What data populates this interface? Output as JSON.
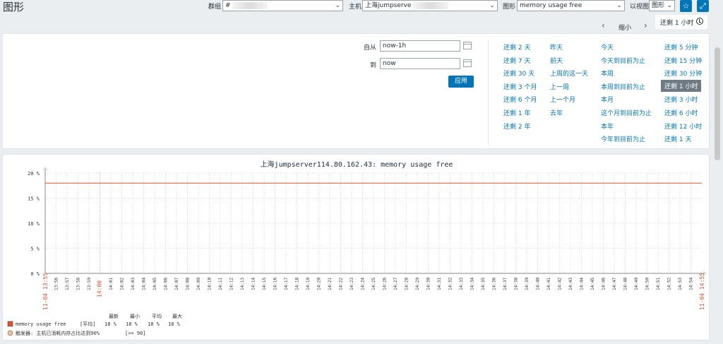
{
  "header": {
    "title": "图形",
    "group_label": "群组",
    "group_value": "#",
    "host_label": "主机",
    "host_value": "上海jumpserve",
    "graph_label": "图形",
    "graph_value": "memory usage free",
    "view_label": "以视图",
    "view_value": "图形"
  },
  "timebar": {
    "zoom_label": "缩小",
    "period_tab": "还剩 1 小时"
  },
  "filter": {
    "from_label": "自从",
    "from_value": "now-1h",
    "to_label": "到",
    "to_value": "now",
    "apply_label": "应用",
    "quick_ranges": [
      [
        "还剩 2 天",
        "还剩 7 天",
        "还剩 30 天",
        "还剩 3 个月",
        "还剩 6 个月",
        "还剩 1 年",
        "还剩 2 年"
      ],
      [
        "昨天",
        "前天",
        "上周的这一天",
        "上一周",
        "上一个月",
        "去年"
      ],
      [
        "今天",
        "今天到目前为止",
        "本周",
        "本周到目前为止",
        "本月",
        "这个月到目前为止",
        "本年",
        "今年到目前为止"
      ],
      [
        "还剩 5 分钟",
        "还剩 15 分钟",
        "还剩 30 分钟",
        "还剩 1 小时",
        "还剩 3 小时",
        "还剩 6 小时",
        "还剩 12 小时",
        "还剩 1 天"
      ]
    ],
    "active_range": "还剩 1 小时"
  },
  "chart_data": {
    "type": "line",
    "title": "上海jumpserver114.80.162.43: memory usage free",
    "ylim": [
      0,
      20
    ],
    "yticks": [
      "0 %",
      "5 %",
      "10 %",
      "15 %",
      "20 %"
    ],
    "x_start_label": "11-04 13:55",
    "x_end_label": "11-04 14:55",
    "x_highlight_label": "14:00",
    "x_ticks": [
      "13:56",
      "13:57",
      "13:58",
      "13:59",
      "14:00",
      "14:01",
      "14:02",
      "14:03",
      "14:04",
      "14:05",
      "14:06",
      "14:07",
      "14:08",
      "14:09",
      "14:10",
      "14:11",
      "14:12",
      "14:13",
      "14:14",
      "14:15",
      "14:16",
      "14:17",
      "14:18",
      "14:19",
      "14:20",
      "14:21",
      "14:22",
      "14:23",
      "14:24",
      "14:25",
      "14:26",
      "14:27",
      "14:28",
      "14:29",
      "14:30",
      "14:31",
      "14:32",
      "14:33",
      "14:34",
      "14:35",
      "14:36",
      "14:37",
      "14:38",
      "14:39",
      "14:40",
      "14:41",
      "14:42",
      "14:43",
      "14:44",
      "14:45",
      "14:46",
      "14:47",
      "14:48",
      "14:49",
      "14:50",
      "14:51",
      "14:52",
      "14:53",
      "14:54"
    ],
    "series": [
      {
        "name": "memory usage free",
        "color": "#e0532f",
        "values": [
          18,
          18
        ]
      }
    ],
    "legend": {
      "headers": [
        "最新",
        "最小",
        "平均",
        "最大"
      ],
      "rows": [
        {
          "name": "memory usage free",
          "func": "[平均]",
          "last": "18 %",
          "min": "18 %",
          "avg": "18 %",
          "max": "18 %"
        }
      ],
      "trigger": {
        "text": "触发器: 主机已消耗内存占比达到90%",
        "condition": "[>= 90]"
      }
    }
  }
}
